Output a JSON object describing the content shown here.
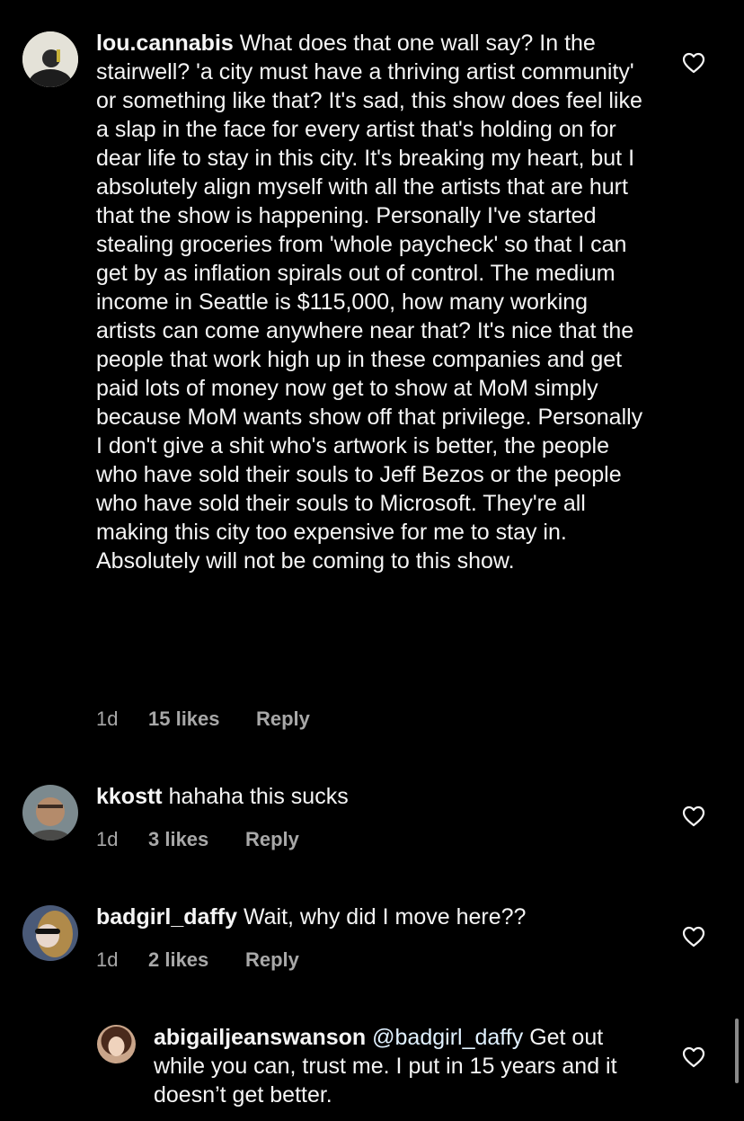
{
  "comments": [
    {
      "username": "lou.cannabis",
      "body": "What does that one wall say? In the stairwell? 'a city must have a thriving artist community' or something like that? It's sad, this show does feel like a slap in the face for every artist that's holding on for dear life to stay in this city. It's breaking my heart, but I absolutely align myself with all the artists that are hurt that the show is happening. Personally I've started stealing groceries from 'whole paycheck' so that I can get by as inflation spirals out of control. The medium income in Seattle is $115,000, how many working artists can come anywhere near that? It's nice that the people that work high up in these companies and get paid lots of money now get to show at MoM simply because MoM wants show off that privilege. Personally I don't give a shit who's artwork is better, the people who have sold their souls to Jeff Bezos or the people who have sold their souls to Microsoft. They're all making this city too expensive for me to stay in. Absolutely will not be coming to this show.",
      "time": "1d",
      "likes": "15 likes",
      "reply": "Reply"
    },
    {
      "username": "kkostt",
      "body": "hahaha this sucks",
      "time": "1d",
      "likes": "3 likes",
      "reply": "Reply"
    },
    {
      "username": "badgirl_daffy",
      "body": "Wait, why did I move here??",
      "time": "1d",
      "likes": "2 likes",
      "reply": "Reply"
    },
    {
      "username": "abigailjeanswanson",
      "mention": "@badgirl_daffy",
      "body": "Get out while you can, trust me. I put in 15 years and it doesn’t get better."
    }
  ],
  "colors": {
    "background": "#000000",
    "text": "#f5f5f5",
    "secondary": "#a8a8a8",
    "mention": "#e0f1ff"
  },
  "icons": {
    "like": "heart-outline-icon"
  }
}
